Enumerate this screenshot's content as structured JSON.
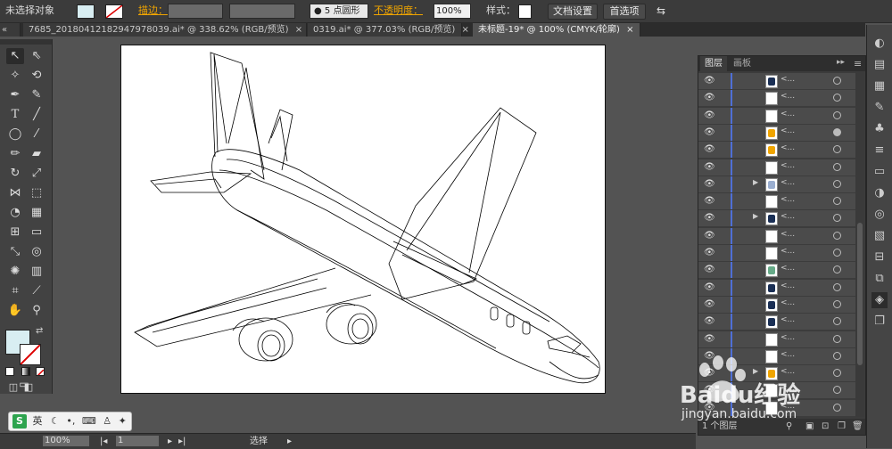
{
  "control_bar": {
    "selection_label": "未选择对象",
    "stroke_label": "描边：",
    "brush_label": "5 点圆形",
    "opacity_label": "不透明度：",
    "opacity_value": "100%",
    "style_label": "样式：",
    "doc_settings_label": "文档设置",
    "preferences_label": "首选项"
  },
  "tabs": [
    {
      "label": "7685_20180412182947978039.ai* @ 338.62% (RGB/预览)"
    },
    {
      "label": "0319.ai* @ 377.03% (RGB/预览)"
    },
    {
      "label": "未标题-19* @ 100% (CMYK/轮廓)"
    }
  ],
  "tab_collapse_glyph": "«",
  "close_glyph": "×",
  "layers_panel": {
    "tabs": [
      "图层",
      "画板"
    ],
    "item_name": "<...",
    "footer_label": "1 个图层",
    "thumb_colors": [
      "#1a2f55",
      "#ffffff",
      "#ffffff",
      "#f0a500",
      "#f0a500",
      "#ffffff",
      "#9aaed0",
      "#ffffff",
      "#1a2f55",
      "#ffffff",
      "#ffffff",
      "#6a8",
      "#1a2f55",
      "#1a2f55",
      "#1a2f55",
      "#ffffff",
      "#ffffff",
      "#f0a500",
      "#ffffff",
      "#ffffff"
    ],
    "expand_rows": [
      6,
      8,
      17
    ]
  },
  "status_bar": {
    "zoom": "100%",
    "page": "1",
    "tool_label": "选择"
  },
  "ime_bar": {
    "logo": "S",
    "lang": "英"
  },
  "watermark": {
    "brand": "Baidu经验",
    "url": "jingyan.baidu.com"
  },
  "colors": {
    "fill": "#d8eef2",
    "accent": "#f0a500",
    "layer_bar": "#4f6fd6"
  }
}
